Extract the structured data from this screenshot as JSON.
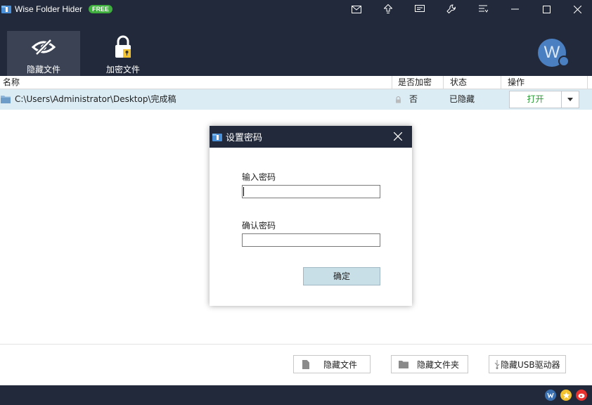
{
  "titlebar": {
    "app_title": "Wise Folder Hider",
    "badge": "FREE",
    "icons": [
      "mail-icon",
      "upgrade-icon",
      "feedback-icon",
      "settings-icon",
      "menu-icon",
      "minimize-icon",
      "maximize-icon",
      "close-icon"
    ]
  },
  "toolbar": {
    "tabs": [
      {
        "label": "隐藏文件",
        "icon": "eye-slash-icon",
        "active": true
      },
      {
        "label": "加密文件",
        "icon": "padlock-icon",
        "active": false
      }
    ],
    "avatar_letter": "W"
  },
  "table": {
    "columns": [
      "名称",
      "是否加密",
      "状态",
      "操作"
    ],
    "rows": [
      {
        "path": "C:\\Users\\Administrator\\Desktop\\完成稿",
        "encrypted": "否",
        "status": "已隐藏",
        "action": "打开"
      }
    ]
  },
  "dialog": {
    "title": "设置密码",
    "password_label": "输入密码",
    "password_value": "",
    "confirm_label": "确认密码",
    "confirm_value": "",
    "ok_label": "确定"
  },
  "bottom": {
    "hide_file": "隐藏文件",
    "hide_folder": "隐藏文件夹",
    "hide_usb": "隐藏USB驱动器"
  },
  "colors": {
    "dark_bg": "#22293a",
    "active_tab": "#3a4253",
    "row_highlight": "#dbecf4",
    "accent_green": "#2a9b36",
    "free_badge": "#3fae3f"
  }
}
